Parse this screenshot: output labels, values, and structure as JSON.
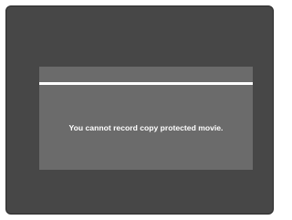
{
  "dialog": {
    "message": "You cannot record copy protected movie."
  },
  "colors": {
    "screen_background": "#474747",
    "dialog_background": "#6b6b6b",
    "text": "#ffffff"
  }
}
